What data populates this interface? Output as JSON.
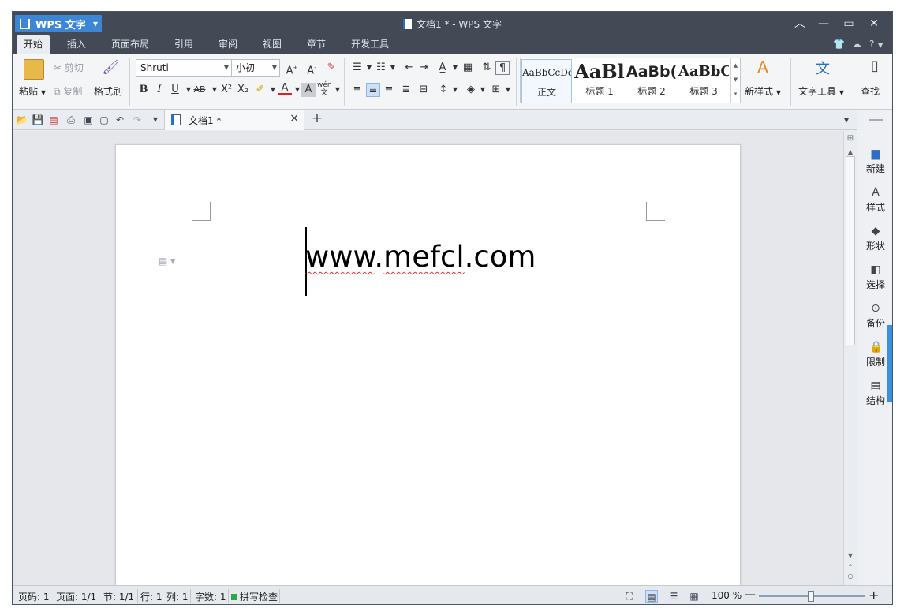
{
  "app": {
    "name": "WPS 文字",
    "window_title": "文档1 * - WPS 文字"
  },
  "menu": {
    "tabs": [
      "开始",
      "插入",
      "页面布局",
      "引用",
      "审阅",
      "视图",
      "章节",
      "开发工具"
    ],
    "active": "开始",
    "help": "?"
  },
  "ribbon": {
    "paste": "粘贴",
    "cut": "剪切",
    "copy": "复制",
    "format_painter": "格式刷",
    "font_name": "Shruti",
    "font_size": "小初",
    "bold": "B",
    "italic": "I",
    "underline": "U",
    "strike": "AB",
    "superscript": "X²",
    "subscript": "X₂",
    "font_color": "A",
    "char_shading": "A",
    "phonetic": "wén",
    "styles": [
      {
        "preview": "AaBbCcDd",
        "label": "正文"
      },
      {
        "preview": "AaBl",
        "label": "标题 1"
      },
      {
        "preview": "AaBb(",
        "label": "标题 2"
      },
      {
        "preview": "AaBbC",
        "label": "标题 3"
      }
    ],
    "new_style": "新样式",
    "text_tools": "文字工具",
    "find": "查找"
  },
  "doc_tabs": {
    "current": "文档1 *",
    "close": "×",
    "add": "+"
  },
  "document": {
    "text_part1": "www",
    "text_dot1": ".",
    "text_part2": "mefcl",
    "text_dot2": ".",
    "text_part3": "com"
  },
  "sidebar": {
    "items": [
      "新建",
      "样式",
      "形状",
      "选择",
      "备份",
      "限制",
      "结构"
    ]
  },
  "status": {
    "page_num": "页码: 1",
    "pages": "页面: 1/1",
    "section": "节: 1/1",
    "row": "行: 1",
    "col": "列: 1",
    "words": "字数: 1",
    "spell_check": "拼写检查",
    "zoom": "100 %"
  },
  "colors": {
    "titlebar": "#434a56",
    "app_button": "#3b86d6",
    "accent": "#2b6fc4",
    "squiggle": "#e03030"
  }
}
